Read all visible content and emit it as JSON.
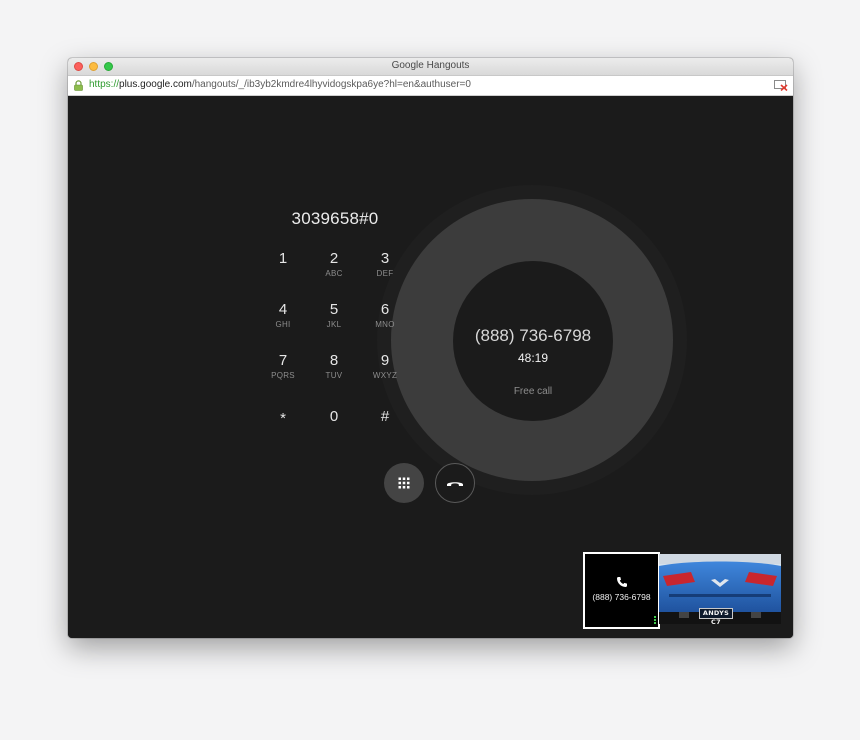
{
  "window": {
    "title": "Google Hangouts"
  },
  "address_bar": {
    "scheme": "https://",
    "host": "plus.google.com",
    "path": "/hangouts/_/ib3yb2kmdre4lhyvidogskpa6ye?hl=en&authuser=0"
  },
  "dialer": {
    "dialed_number": "3039658#0",
    "keys": [
      {
        "digit": "1",
        "letters": ""
      },
      {
        "digit": "2",
        "letters": "ABC"
      },
      {
        "digit": "3",
        "letters": "DEF"
      },
      {
        "digit": "4",
        "letters": "GHI"
      },
      {
        "digit": "5",
        "letters": "JKL"
      },
      {
        "digit": "6",
        "letters": "MNO"
      },
      {
        "digit": "7",
        "letters": "PQRS"
      },
      {
        "digit": "8",
        "letters": "TUV"
      },
      {
        "digit": "9",
        "letters": "WXYZ"
      },
      {
        "digit": "*",
        "letters": ""
      },
      {
        "digit": "0",
        "letters": ""
      },
      {
        "digit": "#",
        "letters": ""
      }
    ]
  },
  "call": {
    "number": "(888) 736-6798",
    "duration": "48:19",
    "note": "Free call"
  },
  "thumbnails": {
    "call_label": "(888) 736-6798",
    "plate_text": "ANDYS C7"
  },
  "colors": {
    "background": "#1b1b1b",
    "ring": "#3c3c3c",
    "signal": "#3fcf4c",
    "url_secure": "#2f9b2f"
  },
  "icons": {
    "dialpad_button": "dialpad-icon",
    "hangup_button": "hang-up-icon",
    "secure": "lock-icon",
    "blocked": "blocked-popup-icon"
  }
}
